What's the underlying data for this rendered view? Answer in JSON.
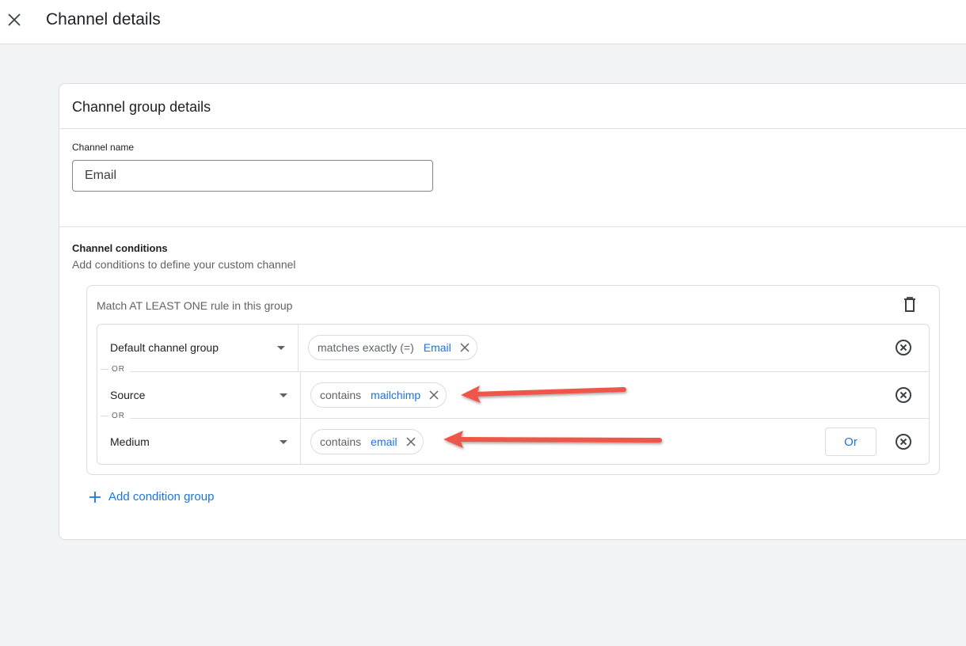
{
  "header": {
    "title": "Channel details",
    "close_icon": "close-icon"
  },
  "card": {
    "title": "Channel group details",
    "channel_name": {
      "label": "Channel name",
      "value": "Email"
    },
    "conditions": {
      "title": "Channel conditions",
      "subtitle": "Add conditions to define your custom channel",
      "group": {
        "label": "Match AT LEAST ONE rule in this group",
        "delete_icon": "trash-icon",
        "separator": "OR",
        "rules": [
          {
            "dimension": "Default channel group",
            "operator": "matches exactly (=)",
            "value": "Email"
          },
          {
            "dimension": "Source",
            "operator": "contains",
            "value": "mailchimp"
          },
          {
            "dimension": "Medium",
            "operator": "contains",
            "value": "email"
          }
        ],
        "or_button_label": "Or"
      },
      "add_group_label": "Add condition group"
    }
  },
  "annotations": {
    "arrow_color": "#f0554a",
    "arrows": [
      "points-to-mailchimp-chip",
      "points-to-email-chip"
    ]
  },
  "colors": {
    "accent": "#1a73e8",
    "text_primary": "#202124",
    "text_secondary": "#5f6368",
    "border": "#dadce0",
    "background": "#f1f3f4"
  }
}
